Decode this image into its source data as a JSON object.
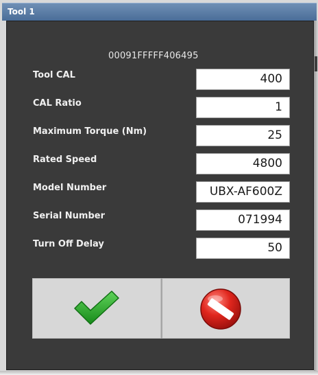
{
  "window": {
    "title": "Tool 1"
  },
  "tool_id": "00091FFFFF406495",
  "fields": [
    {
      "label": "Tool CAL",
      "value": "400"
    },
    {
      "label": "CAL Ratio",
      "value": "1"
    },
    {
      "label": "Maximum Torque (Nm)",
      "value": "25"
    },
    {
      "label": "Rated Speed",
      "value": "4800"
    },
    {
      "label": "Model Number",
      "value": "UBX-AF600Z"
    },
    {
      "label": "Serial Number",
      "value": "071994"
    },
    {
      "label": "Turn Off Delay",
      "value": "50"
    }
  ],
  "buttons": {
    "ok_icon": "green-checkmark-icon",
    "cancel_icon": "red-no-entry-icon"
  },
  "colors": {
    "title_bar": "#4a6d98",
    "panel_background": "#3a3a3a",
    "ok_green": "#2ea62e",
    "cancel_red": "#d8261e"
  }
}
